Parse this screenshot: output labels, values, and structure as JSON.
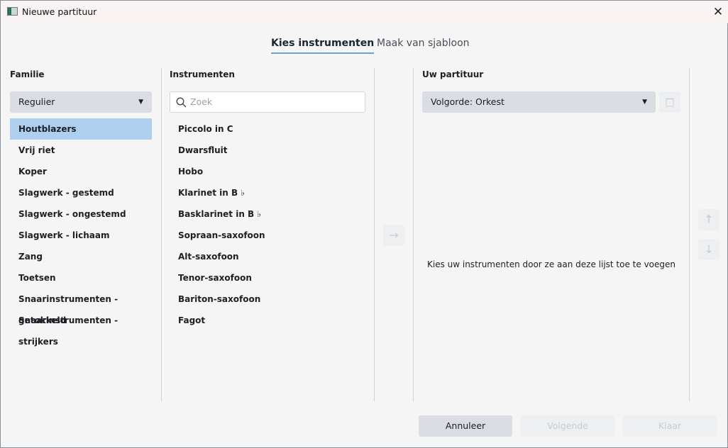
{
  "window": {
    "title": "Nieuwe partituur",
    "close_icon": "close-icon"
  },
  "tabs": [
    {
      "label": "Kies instrumenten",
      "active": true
    },
    {
      "label": "Maak van sjabloon",
      "active": false
    }
  ],
  "family": {
    "header": "Familie",
    "dropdown_value": "Regulier",
    "items": [
      "Houtblazers",
      "Vrij riet",
      "Koper",
      "Slagwerk - gestemd",
      "Slagwerk - ongestemd",
      "Slagwerk - lichaam",
      "Zang",
      "Toetsen",
      "Snaarinstrumenten - getokkeld",
      "Snaarinstrumenten - strijkers"
    ],
    "selected": "Houtblazers"
  },
  "instruments": {
    "header": "Instrumenten",
    "search_placeholder": "Zoek",
    "search_value": "",
    "items": [
      "Piccolo in C",
      "Dwarsfluit",
      "Hobo",
      "Klarinet in B ♭",
      "Basklarinet in B ♭",
      "Sopraan-saxofoon",
      "Alt-saxofoon",
      "Tenor-saxofoon",
      "Bariton-saxofoon",
      "Fagot"
    ]
  },
  "score": {
    "header": "Uw partituur",
    "order_value": "Volgorde: Orkest",
    "empty_message": "Kies uw instrumenten door ze aan deze lijst toe te voegen"
  },
  "icons": {
    "add": "→",
    "up": "↑",
    "down": "↓"
  },
  "footer": {
    "cancel": "Annuleer",
    "next": "Volgende",
    "done": "Klaar"
  },
  "colors": {
    "selection": "#afcfee",
    "tab_underline": "#6fa0cf"
  }
}
